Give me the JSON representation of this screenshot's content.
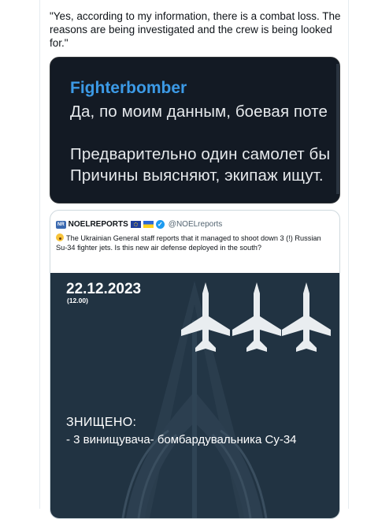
{
  "tweet": {
    "quote_text": "\"Yes, according to my information, there is a combat loss. The reasons are being investigated and the crew is being looked for.\""
  },
  "screenshot": {
    "name": "Fighterbomber",
    "line1": "Да, по моим данным, боевая поте",
    "line2": "Предварительно один самолет бы",
    "line3": "Причины выясняют, экипаж ищут.",
    "colors": {
      "background": "#131a24",
      "name": "#3c9ae6",
      "text": "#e6e9ec"
    }
  },
  "quoted_tweet": {
    "badge": "NR",
    "account_name": "NOELREPORTS",
    "handle": "@NOELreports",
    "text": "The Ukrainian General staff reports that it managed to shoot down 3 (!) Russian Su-34 fighter jets. Is this new air defense deployed in the south?",
    "icons": [
      "eu-flag-icon",
      "ukraine-flag-icon",
      "verified-icon",
      "astonished-face-icon"
    ],
    "image": {
      "date": "22.12.2023",
      "time": "(12.00)",
      "heading": "ЗНИЩЕНО:",
      "item": "- 3 винищувача- бомбардувальника Су-34",
      "plane_count": 3,
      "colors": {
        "background": "#213342",
        "plane": "#e9edf0"
      }
    }
  }
}
